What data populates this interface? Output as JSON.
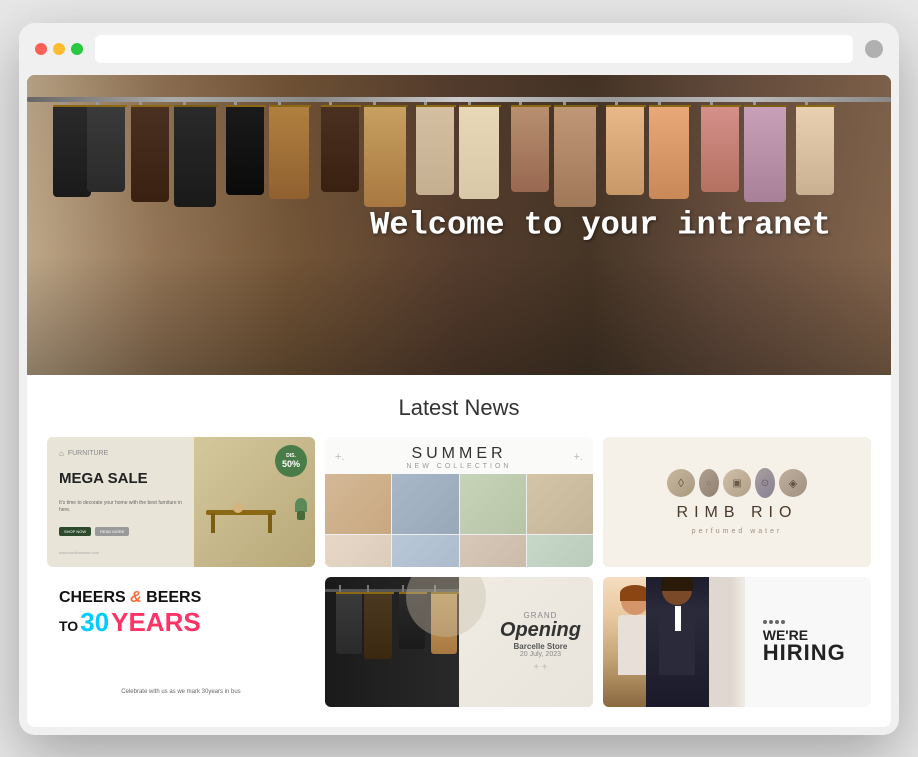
{
  "browser": {
    "traffic_lights": [
      "red",
      "yellow",
      "green"
    ],
    "address_bar_placeholder": ""
  },
  "hero": {
    "welcome_text": "Welcome to your intranet"
  },
  "section": {
    "latest_news_title": "Latest News"
  },
  "cards": {
    "furniture": {
      "brand_label": "FURNITURE",
      "title": "MEGA SALE",
      "subtitle": "It's time to decorate your home with the best furniture in here.",
      "shop_btn": "SHOP NOW",
      "read_btn": "READ MORE",
      "website": "www.furnituresale.com",
      "discount_label": "Dis.",
      "discount_value": "50%"
    },
    "summer": {
      "title": "SUMMER",
      "subtitle": "NEW COLLECTION"
    },
    "rimboirio": {
      "name": "RIMB RIO",
      "subtitle": "perfumed water"
    },
    "cheers": {
      "line1a": "CHEERS",
      "line1b": "&",
      "line1c": "BEERS",
      "line2a": "TO ",
      "line2b": "30",
      "line2c": "YEARS",
      "subtitle": "Celebrate with us as we mark 30years in bus"
    },
    "grand": {
      "label": "Grand",
      "title": "Opening",
      "store": "Barcelle Store",
      "date": "20 July, 2023"
    },
    "hiring": {
      "were": "WE'RE",
      "hiring": "HIRING"
    }
  }
}
